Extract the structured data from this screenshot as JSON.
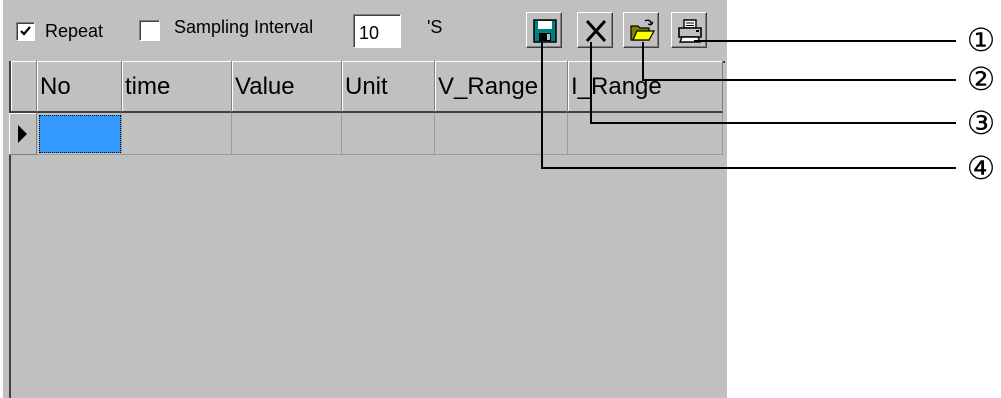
{
  "toolbar": {
    "repeat": {
      "label": "Repeat",
      "checked": true
    },
    "sampling": {
      "label": "Sampling Interval",
      "checked": false
    },
    "interval_value": "10",
    "unit_label": "'S",
    "buttons": [
      {
        "name": "save-button",
        "icon": "floppy-disk-icon"
      },
      {
        "name": "delete-button",
        "icon": "x-icon"
      },
      {
        "name": "open-folder-button",
        "icon": "open-folder-icon"
      },
      {
        "name": "print-button",
        "icon": "printer-icon"
      }
    ]
  },
  "grid": {
    "columns": [
      "No",
      "time",
      "Value",
      "Unit",
      "V_Range",
      "I_Range"
    ],
    "rows": [
      [
        "",
        "",
        "",
        "",
        "",
        ""
      ]
    ],
    "selection_color": "#3399ff"
  },
  "callouts": [
    "①",
    "②",
    "③",
    "④"
  ]
}
